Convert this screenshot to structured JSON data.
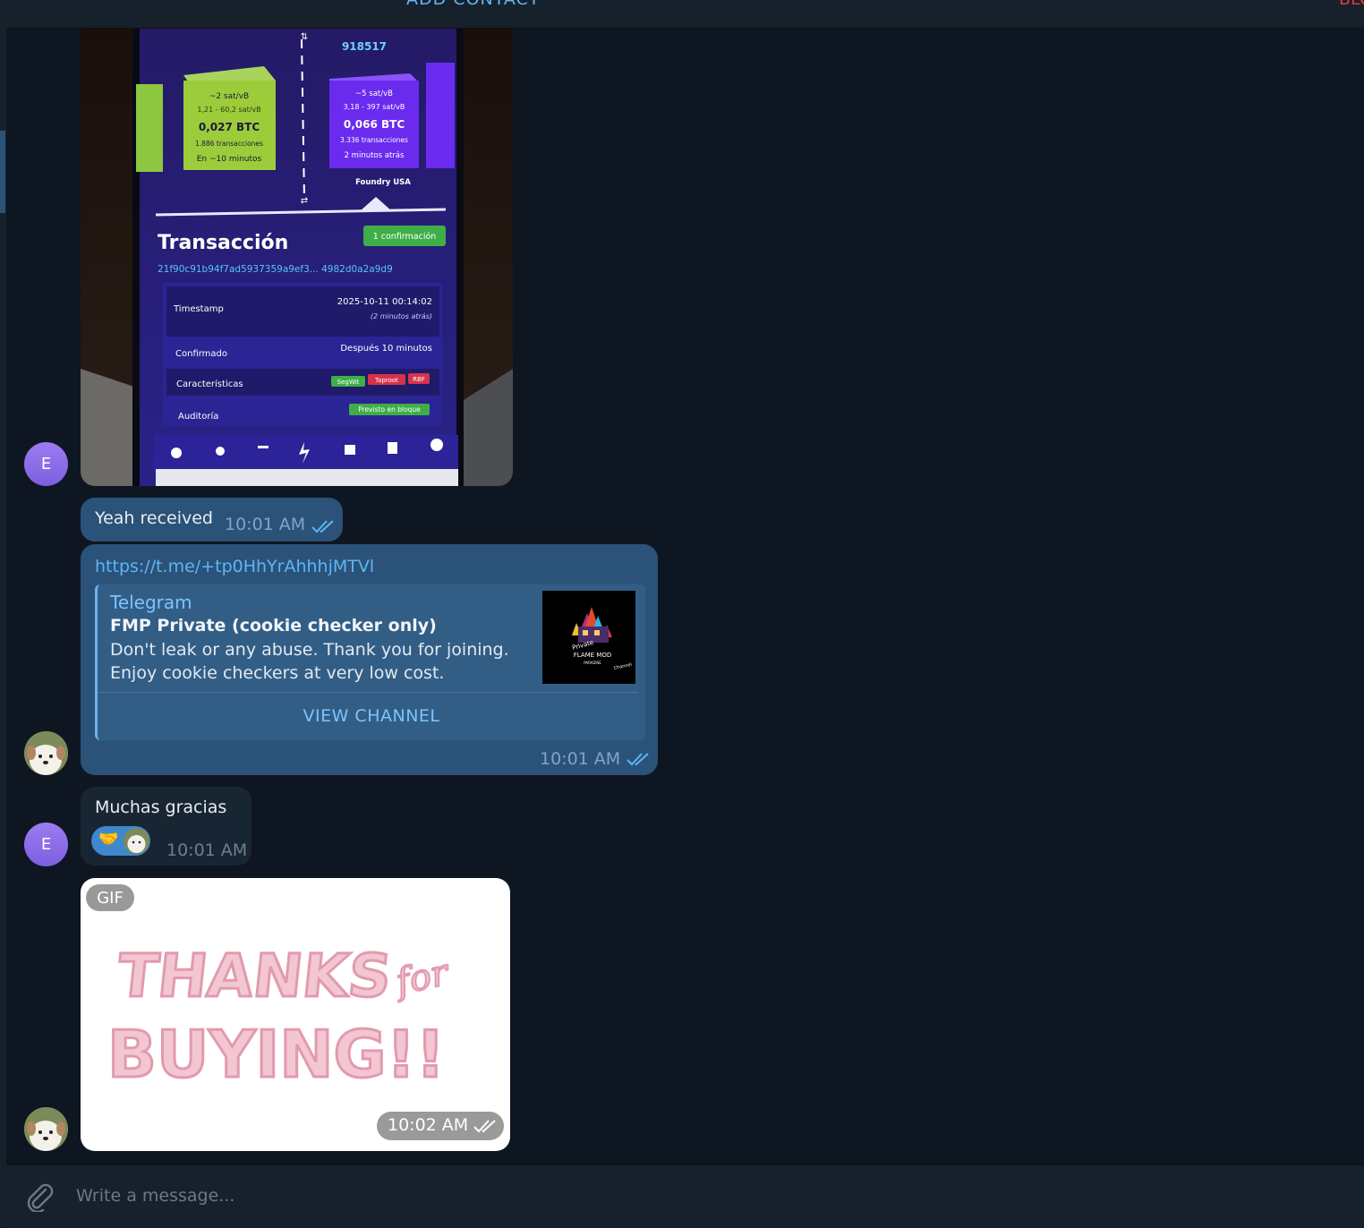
{
  "header": {
    "add_contact": "ADD CONTACT",
    "block": "BLOCK"
  },
  "photo": {
    "block_number": "918517",
    "left_block": {
      "fee": "~2 sat/vB",
      "range": "1,21 - 60,2 sat/vB",
      "amount": "0,027 BTC",
      "tx": "1.886 transacciones",
      "eta": "En ~10 minutos"
    },
    "right_block": {
      "fee": "~5 sat/vB",
      "range": "3,18 - 397 sat/vB",
      "amount": "0,066 BTC",
      "tx": "3.336 transacciones",
      "eta": "2 minutos atrás"
    },
    "miner": "Foundry USA",
    "title": "Transacción",
    "confirm_badge": "1 confirmación",
    "txid": "21f90c91b94f7ad5937359a9ef3... 4982d0a2a9d9",
    "rows": {
      "timestamp_label": "Timestamp",
      "timestamp_value": "2025-10-11 00:14:02",
      "timestamp_sub": "(2 minutos atrás)",
      "confirmed_label": "Confirmado",
      "confirmed_value": "Después 10 minutos",
      "features_label": "Características",
      "audit_label": "Auditoría",
      "audit_value": "Previsto en bloque"
    },
    "tags": [
      "SegWit",
      "Taproot",
      "RBF"
    ]
  },
  "messages": {
    "m1": {
      "text": "Yeah received",
      "time": "10:01 AM"
    },
    "m2": {
      "link": "https://t.me/+tp0HhYrAhhhjMTVl",
      "site": "Telegram",
      "title": "FMP Private (cookie checker only)",
      "description": "Don't leak or any abuse. Thank you for joining. Enjoy cookie checkers at very low cost.",
      "button": "VIEW CHANNEL",
      "time": "10:01 AM"
    },
    "m3": {
      "text": "Muchas gracias",
      "time": "10:01 AM"
    },
    "m4": {
      "gif_label": "GIF",
      "time": "10:02 AM"
    }
  },
  "avatars": {
    "contact_initial": "E"
  },
  "composer": {
    "placeholder": "Write a message..."
  },
  "colors": {
    "outgoing": "#2b5278",
    "incoming": "#182533",
    "link": "#5eb5f7",
    "background": "#0e1621"
  }
}
